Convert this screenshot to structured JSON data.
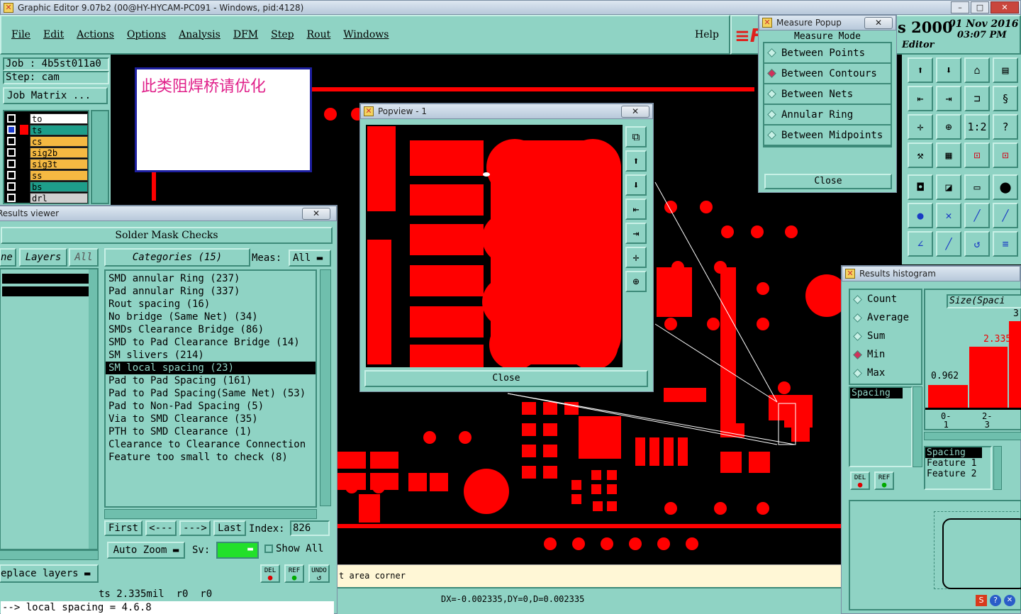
{
  "window": {
    "title": "Graphic Editor 9.07b2 (00@HY-HYCAM-PC091 - Windows, pid:4128)"
  },
  "menu": [
    "File",
    "Edit",
    "Actions",
    "Options",
    "Analysis",
    "DFM",
    "Step",
    "Rout",
    "Windows"
  ],
  "help": "Help",
  "brand": {
    "year_text": "s 2000",
    "date": "01 Nov 2016",
    "time": "03:07 PM",
    "sub": "Editor"
  },
  "job": {
    "job_label": "Job : 4b5st011a0",
    "step_label": "Step: cam",
    "matrix_btn": "Job Matrix ..."
  },
  "layers": [
    {
      "name": "to",
      "color": "#ffffff"
    },
    {
      "name": "ts",
      "color": "#1e9e8a"
    },
    {
      "name": "cs",
      "color": "#f5b942"
    },
    {
      "name": "sig2b",
      "color": "#f5b942"
    },
    {
      "name": "sig3t",
      "color": "#f5b942"
    },
    {
      "name": "ss",
      "color": "#f5b942"
    },
    {
      "name": "bs",
      "color": "#1e9e8a"
    },
    {
      "name": "drl",
      "color": "#cfcfcf"
    }
  ],
  "note": "此类阻焊桥请优化",
  "results_viewer": {
    "title": "Results viewer",
    "section": "Solder Mask Checks",
    "col_ne": "ne",
    "col_layers": "Layers",
    "col_all": "All",
    "categories_btn": "Categories (15)",
    "meas_label": "Meas:",
    "meas_value": "All",
    "categories": [
      "SMD annular Ring (237)",
      "Pad annular Ring (337)",
      "Rout spacing (16)",
      "No bridge (Same Net) (34)",
      "SMDs Clearance Bridge (86)",
      "SMD to Pad Clearance Bridge (14)",
      "SM slivers (214)",
      "SM local spacing (23)",
      "Pad to Pad Spacing (161)",
      "Pad to Pad Spacing(Same Net) (53)",
      "Pad to Non-Pad Spacing (5)",
      "Via to SMD Clearance (35)",
      "PTH to SMD Clearance (1)",
      "Clearance to Clearance Connection",
      "Feature too small to check (8)"
    ],
    "selected_index": 7,
    "nav": {
      "first": "First",
      "prev": "<---",
      "next": "--->",
      "last": "Last",
      "index_label": "Index:",
      "index_value": "826"
    },
    "auto_zoom": "Auto Zoom",
    "sv_label": "Sv:",
    "show_all": "Show All",
    "replace_layers": "eplace layers",
    "del": "DEL",
    "ref": "REF",
    "undo": "UNDO",
    "status1": "ts 2.335mil  r0  r0",
    "status2": "--> local spacing = 4.6.8"
  },
  "popview": {
    "title": "Popview - 1",
    "close": "Close"
  },
  "measure": {
    "title": "Measure Popup",
    "mode_label": "Measure Mode",
    "options": [
      "Between Points",
      "Between Contours",
      "Between Nets",
      "Annular Ring",
      "Between Midpoints"
    ],
    "selected": 1,
    "close": "Close"
  },
  "toolbar_icons": [
    "⬆",
    "⬇",
    "⌂",
    "▤",
    "⇤",
    "⇥",
    "⊐",
    "§",
    "✛",
    "⊕",
    "1:2",
    "?",
    "⚒",
    "▦",
    "⊡",
    "⊡",
    "◘",
    "◪",
    "▭",
    "⬤",
    "●",
    "✕",
    "╱",
    "╱",
    "∠",
    "╱",
    "↺",
    "≡"
  ],
  "histogram": {
    "title": "Results histogram",
    "options": [
      "Count",
      "Average",
      "Sum",
      "Min",
      "Max"
    ],
    "selected": 3,
    "size_label": "Size(Spaci",
    "spacing_label": "Spacing",
    "del": "DEL",
    "ref": "REF",
    "value_top": "3.",
    "value_mid": "2.335",
    "value_low": "0.962",
    "bins": [
      "0-\n1",
      "2-\n3"
    ],
    "legend": [
      "Spacing",
      "Feature 1",
      "Feature 2"
    ]
  },
  "prompt_text": "t area corner",
  "measure_readout": "DX=-0.002335,DY=0,D=0.002335"
}
